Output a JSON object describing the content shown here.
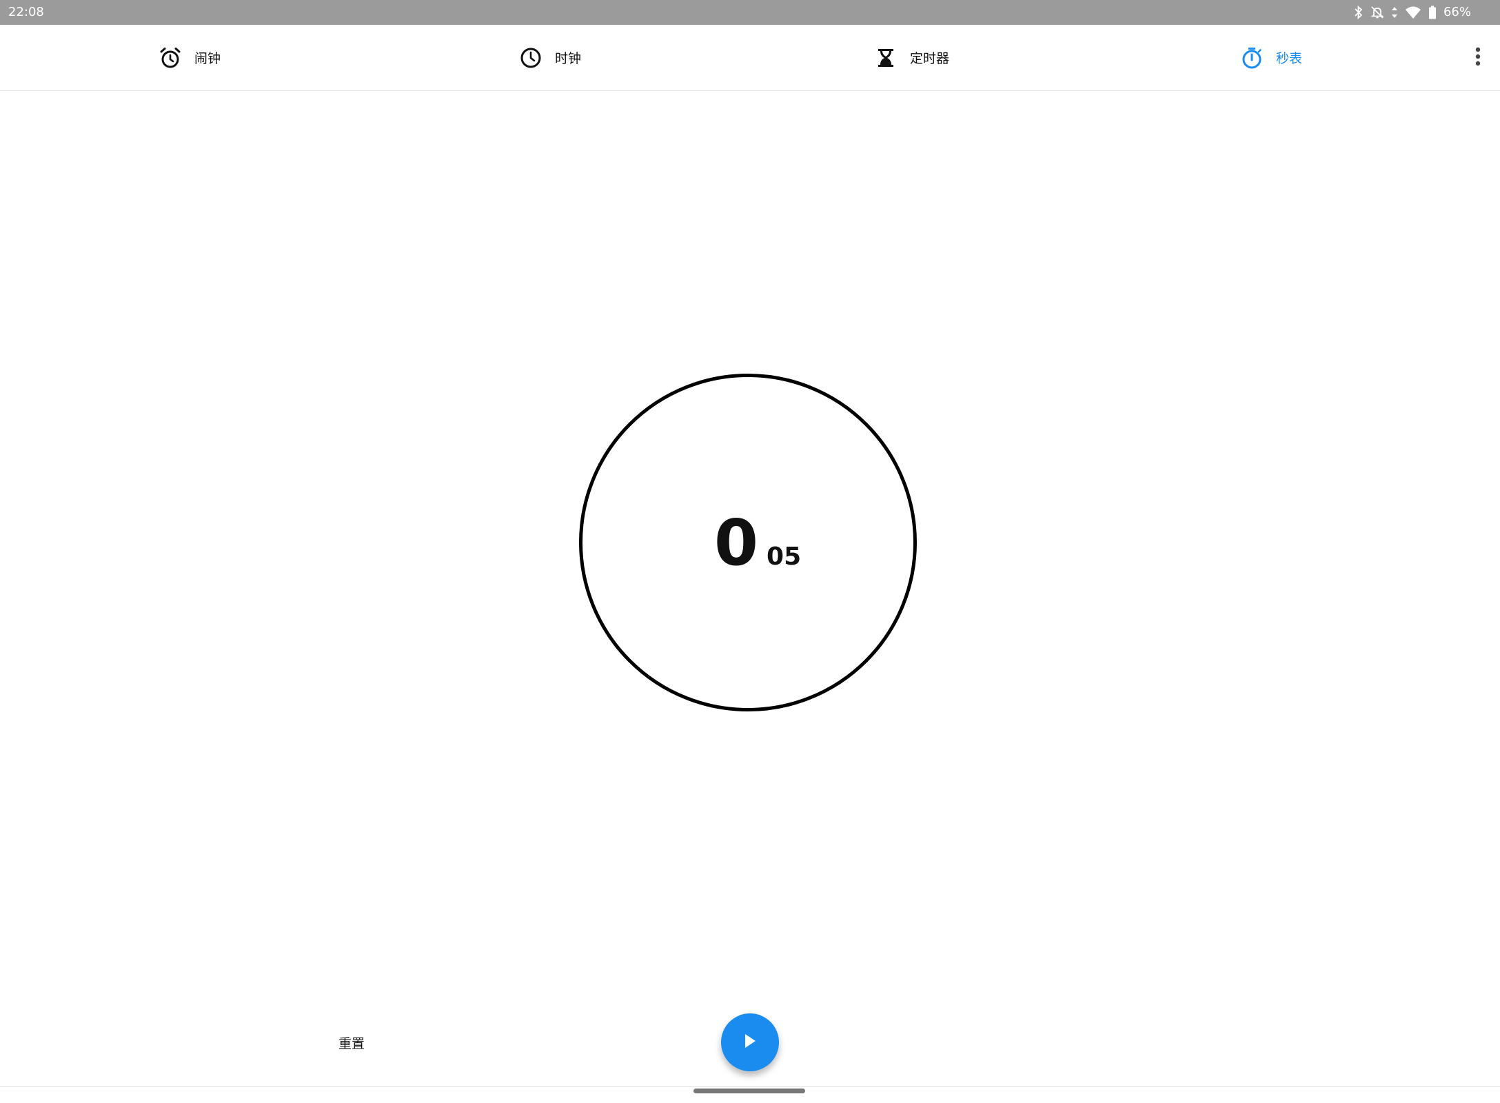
{
  "status_bar": {
    "time": "22:08",
    "battery_percent": "66%",
    "icons": [
      "bluetooth-icon",
      "notifications-off-icon",
      "data-arrows-icon",
      "wifi-icon",
      "battery-icon"
    ]
  },
  "tabs": [
    {
      "label": "闹钟",
      "icon": "alarm-icon",
      "active": false
    },
    {
      "label": "时钟",
      "icon": "clock-icon",
      "active": false
    },
    {
      "label": "定时器",
      "icon": "hourglass-icon",
      "active": false
    },
    {
      "label": "秒表",
      "icon": "stopwatch-icon",
      "active": true
    }
  ],
  "menu": {
    "icon": "more-vert-icon"
  },
  "stopwatch": {
    "seconds": "0",
    "hundredths": "05"
  },
  "controls": {
    "reset_label": "重置",
    "play_icon": "play-icon"
  },
  "colors": {
    "accent": "#1a8cf0",
    "status_bar_bg": "#9b9b9b",
    "text": "#111111"
  }
}
